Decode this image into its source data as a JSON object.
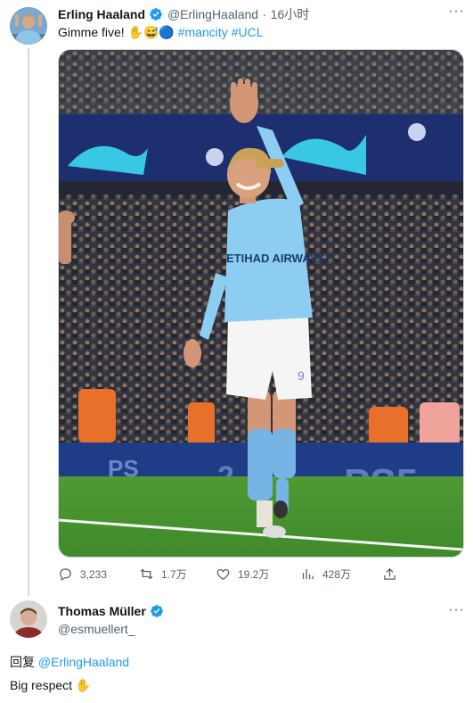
{
  "tweet": {
    "author_name": "Erling Haaland",
    "handle": "@ErlingHaaland",
    "separator": "·",
    "time": "16小时",
    "text": "Gimme five! ✋😅🔵",
    "hashtag1": "#mancity",
    "hashtag2": "#UCL",
    "photo": {
      "jersey_sponsor": "ETIHAD AIRWAYS",
      "jersey_number": "9",
      "board_text_left": "PS",
      "board_text_center": "2",
      "board_text_right": "PS5"
    },
    "actions": {
      "replies": "3,233",
      "retweets": "1.7万",
      "likes": "19.2万",
      "views": "428万"
    }
  },
  "reply": {
    "author_name": "Thomas Müller",
    "handle": "@esmuellert_",
    "reply_prefix": "回复",
    "reply_to": "@ErlingHaaland",
    "text": "Big respect ✋"
  },
  "colors": {
    "verified": "#1d9bf0",
    "link": "#1d9bf0",
    "muted": "#536471",
    "divider": "#cfd9de"
  }
}
